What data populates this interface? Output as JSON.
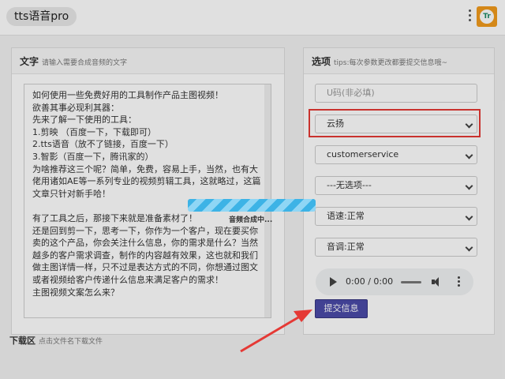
{
  "header": {
    "app_title": "tts语音pro",
    "ext_icon_letters": "Tr"
  },
  "left_panel": {
    "title": "文字",
    "hint": "请输入需要合成音频的文字",
    "text_content": "如何使用一些免费好用的工具制作产品主图视频！\n欲善其事必现利其器：\n先来了解一下使用的工具：\n1.剪映 （百度一下，下载即可）\n2.tts语音（放不了链接，百度一下）\n3.智影（百度一下，腾讯家的）\n为啥推荐这三个呢？简单，免费，容易上手，当然，也有大佬用诸如AE等一系列专业的视频剪辑工具，这就略过，这篇文章只针对新手哈！\n\n有了工具之后，那接下来就是准备素材了！\n还是回到剪一下，思考一下，你作为一个客户，现在要买你卖的这个产品，你会关注什么信息，你的需求是什么？当然越多的客户需求调查，制作的内容越有效果，这也就和我们做主图详情一样，只不过是表达方式的不同，你想通过图文或者视频给客户传递什么信息来满足客户的需求！\n主图视频文案怎么来？"
  },
  "right_panel": {
    "title": "选项",
    "hint": "tips:每次参数更改都要提交信息哦~",
    "u_code_placeholder": "U码(非必填)",
    "voice_select": "云扬",
    "role_select": "customerservice",
    "style_select": "---无选项---",
    "speed_select": "语速:正常",
    "pitch_select": "音调:正常",
    "audio_time": "0:00 / 0:00",
    "submit_label": "提交信息"
  },
  "bottom": {
    "title": "下载区",
    "hint": "点击文件名下载文件"
  },
  "loading": {
    "text": "音频合成中...",
    "bar_color": "#3db3e6"
  },
  "colors": {
    "highlight": "#e53935",
    "submit": "#4a4aa8"
  }
}
